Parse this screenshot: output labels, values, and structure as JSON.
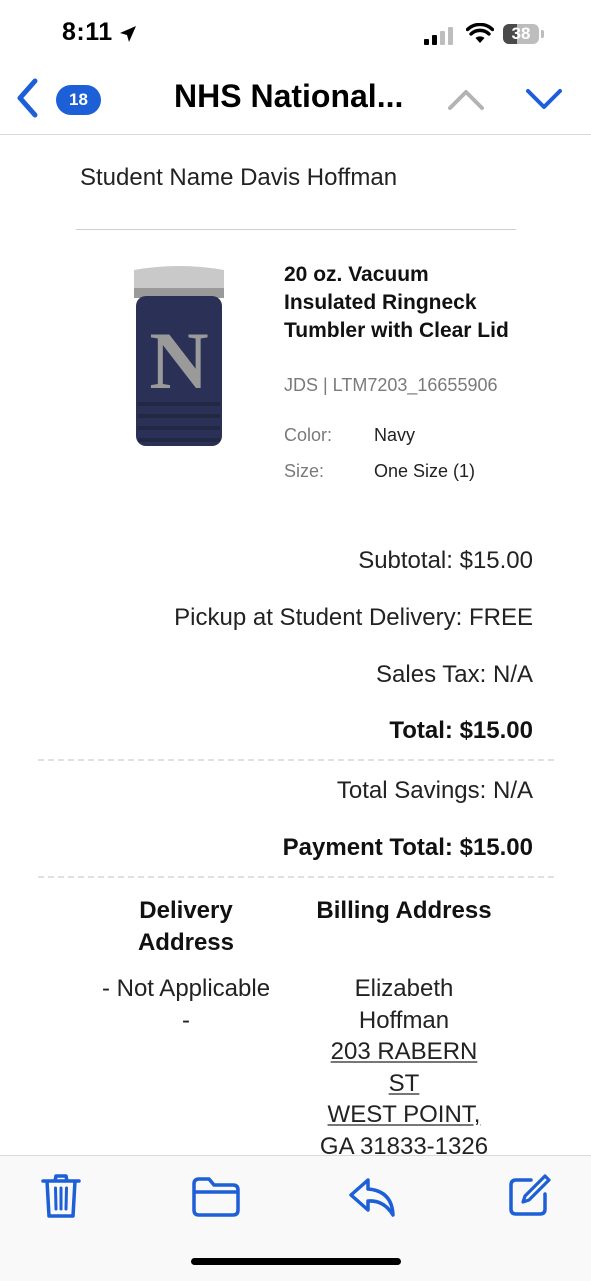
{
  "status_bar": {
    "time": "8:11",
    "battery": "38",
    "battery_level": 0.38,
    "icons": [
      "location-arrow-icon",
      "cellular-signal-icon",
      "wifi-icon",
      "battery-icon"
    ]
  },
  "nav": {
    "unread_count": "18",
    "title": "NHS National...",
    "icons": [
      "chevron-left-icon",
      "chevron-up-icon",
      "chevron-down-icon"
    ]
  },
  "email": {
    "student_name": "Student Name Davis Hoffman",
    "product": {
      "title": "20 oz. Vacuum Insulated Ringneck Tumbler with Clear Lid",
      "sku": "JDS | LTM7203_16655906",
      "image_letter": "N",
      "attributes": [
        {
          "label": "Color:",
          "value": "Navy"
        },
        {
          "label": "Size:",
          "value": "One Size (1)"
        }
      ]
    },
    "summary": {
      "subtotal": "Subtotal: $15.00",
      "pickup": "Pickup at Student Delivery: FREE",
      "sales_tax": "Sales Tax: N/A",
      "total": "Total: $15.00",
      "total_savings": "Total Savings: N/A",
      "payment_total": "Payment Total: $15.00"
    },
    "delivery": {
      "heading_line1": "Delivery",
      "heading_line2": "Address",
      "line1": "- Not Applicable",
      "line2": "-"
    },
    "billing": {
      "heading": "Billing Address",
      "name_line1": "Elizabeth",
      "name_line2": "Hoffman",
      "street_line1": "203 RABERN",
      "street_line2": "ST",
      "city_line1": "WEST POINT,",
      "city_line2": "GA  31833-1326"
    }
  },
  "toolbar": {
    "icons": [
      "trash-icon",
      "folder-icon",
      "reply-icon",
      "compose-icon"
    ]
  },
  "colors": {
    "accent": "#1c5fd6",
    "tumbler": "#2b3156",
    "divider": "#d9d9d9"
  }
}
